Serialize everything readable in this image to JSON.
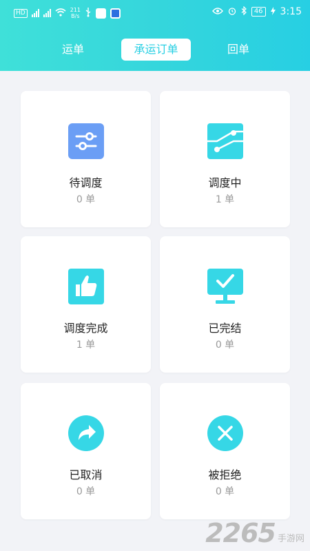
{
  "status_bar": {
    "left_badge": "HD",
    "net_speed_value": "211",
    "net_speed_unit": "B/s",
    "battery": "46",
    "time": "3:15"
  },
  "tabs": [
    {
      "label": "运单",
      "selected": false
    },
    {
      "label": "承运订单",
      "selected": true
    },
    {
      "label": "回单",
      "selected": false
    }
  ],
  "colors": {
    "header_start": "#3fe0d9",
    "header_end": "#27cfe3",
    "blue_accent": "#6b9ef5",
    "cyan_accent": "#36d7e6"
  },
  "cards": [
    {
      "title": "待调度",
      "count": "0 单",
      "icon": "sliders-icon"
    },
    {
      "title": "调度中",
      "count": "1 单",
      "icon": "route-nodes-icon"
    },
    {
      "title": "调度完成",
      "count": "1 单",
      "icon": "thumbs-up-icon"
    },
    {
      "title": "已完结",
      "count": "0 单",
      "icon": "monitor-check-icon"
    },
    {
      "title": "已取消",
      "count": "0 单",
      "icon": "share-arrow-icon"
    },
    {
      "title": "被拒绝",
      "count": "0 单",
      "icon": "close-x-icon"
    }
  ],
  "watermark": {
    "number": "2265",
    "text": "手游网"
  }
}
